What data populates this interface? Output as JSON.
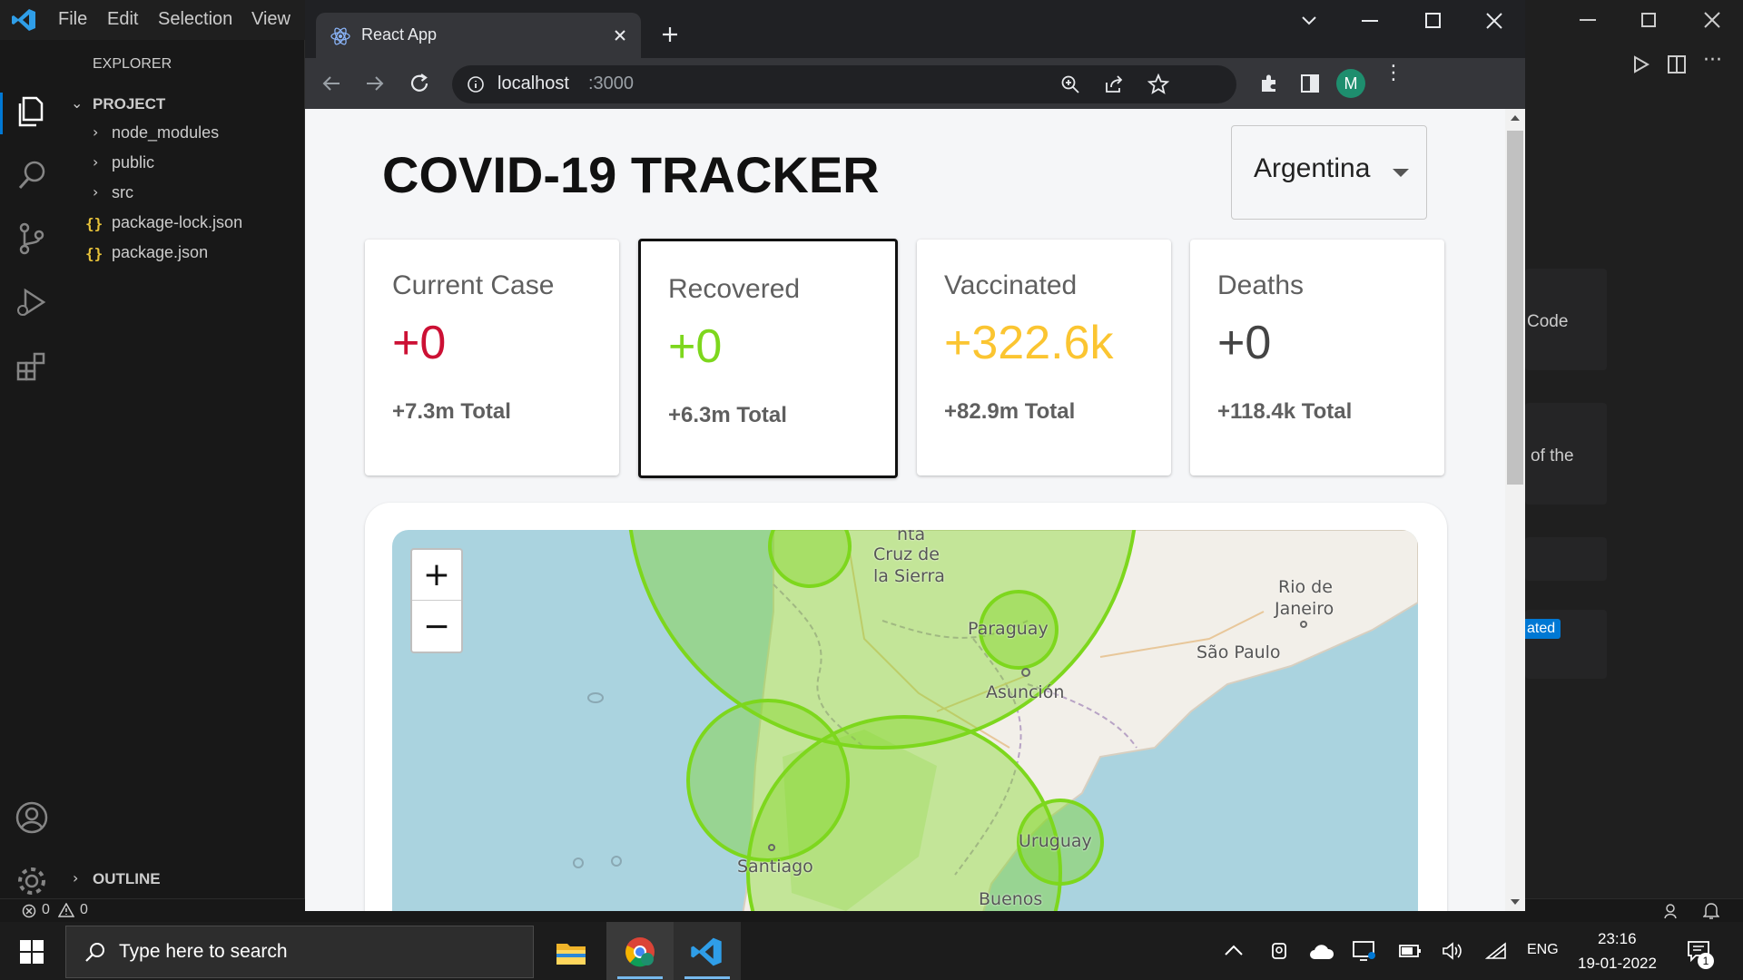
{
  "vscode": {
    "menu": [
      "File",
      "Edit",
      "Selection",
      "View"
    ],
    "explorer_title": "EXPLORER",
    "project_label": "PROJECT",
    "tree": [
      {
        "name": "node_modules",
        "type": "folder"
      },
      {
        "name": "public",
        "type": "folder"
      },
      {
        "name": "src",
        "type": "folder"
      },
      {
        "name": "package-lock.json",
        "type": "json"
      },
      {
        "name": "package.json",
        "type": "json"
      }
    ],
    "outline_label": "OUTLINE",
    "json_glyph": "{}",
    "status": {
      "errors": "0",
      "warnings": "0"
    },
    "right_panel": {
      "text1": "Code",
      "text2": "of the",
      "badge": "ated"
    }
  },
  "browser": {
    "tab_title": "React App",
    "url_host": "localhost",
    "url_port": ":3000",
    "profile_initial": "M"
  },
  "app": {
    "title": "COVID-19 TRACKER",
    "country": "Argentina",
    "cards": [
      {
        "label": "Current Case",
        "value": "+0",
        "total": "+7.3m Total",
        "color": "#cc1034"
      },
      {
        "label": "Recovered",
        "value": "+0",
        "total": "+6.3m Total",
        "color": "#7dd71d"
      },
      {
        "label": "Vaccinated",
        "value": "+322.6k",
        "total": "+82.9m Total",
        "color": "#fbc531"
      },
      {
        "label": "Deaths",
        "value": "+0",
        "total": "+118.4k Total",
        "color": "#444444"
      }
    ],
    "map": {
      "zoom_in": "+",
      "zoom_out": "−",
      "labels": [
        "Cruz de",
        "la Sierra",
        "Rio de",
        "Janeiro",
        "Paraguay",
        "São Paulo",
        "Asunción",
        "Uruguay",
        "Santiago",
        "Buenos",
        "nta"
      ],
      "circle_color": "#7dd71d"
    }
  },
  "taskbar": {
    "search_placeholder": "Type here to search",
    "time": "23:16",
    "date": "19-01-2022",
    "lang": "ENG",
    "notif_count": "1"
  }
}
